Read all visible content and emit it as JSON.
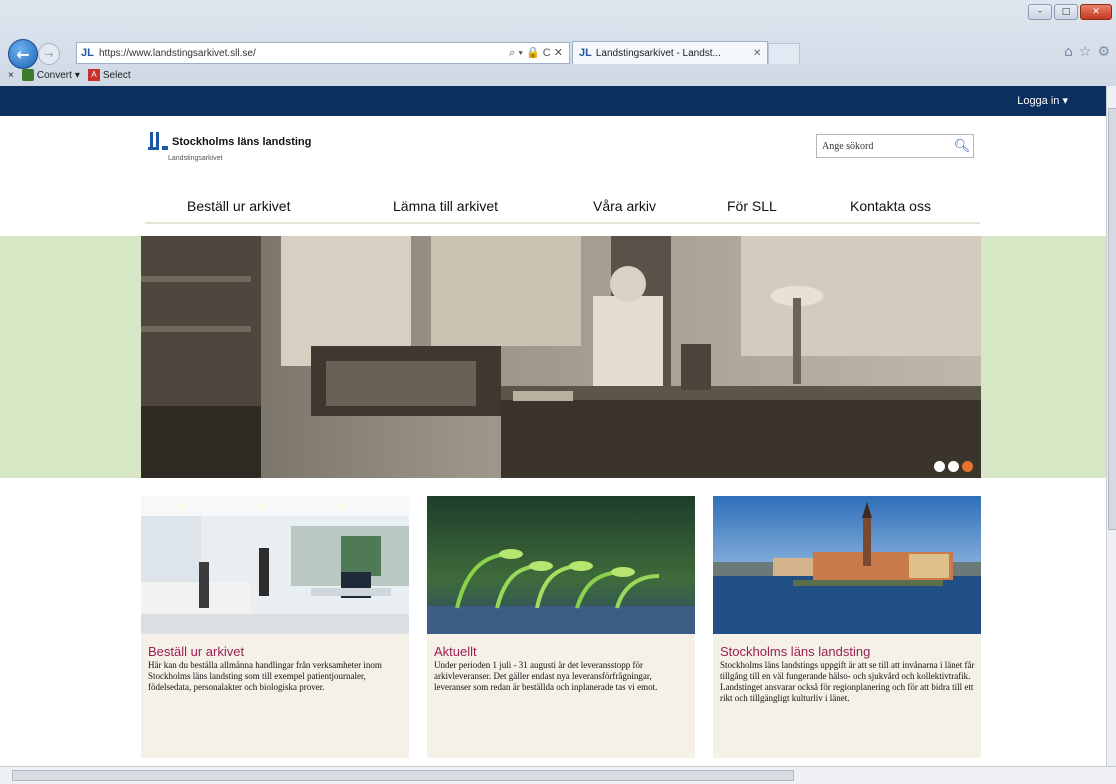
{
  "browser": {
    "url": "https://www.landstingsarkivet.sll.se/",
    "address_controls": "⌕ ▾ 🔒 C ✕",
    "tab_title": "Landstingsarkivet - Landst...",
    "window_controls": [
      "–",
      "□",
      "✕"
    ],
    "toolbar": {
      "close": "×",
      "convert": "Convert",
      "select": "Select"
    },
    "icons": {
      "back": "back-arrow-icon",
      "forward": "forward-arrow-icon",
      "home": "home-icon",
      "favorites": "star-icon",
      "settings": "gear-icon"
    }
  },
  "header": {
    "login": "Logga in ▾",
    "logo_text": "Stockholms läns landsting",
    "logo_subtitle": "Landstingsarkivet",
    "search_placeholder": "Ange sökord"
  },
  "nav": {
    "items": [
      "Beställ ur arkivet",
      "Lämna till arkivet",
      "Våra arkiv",
      "För SLL",
      "Kontakta oss"
    ]
  },
  "hero": {
    "slides": 3,
    "active_slide": 3
  },
  "cards": [
    {
      "title": "Beställ ur arkivet",
      "text": "Här kan du beställa allmänna handlingar från verksamheter inom Stockholms läns landsting som till exempel patientjournaler, födelsedata, personalakter och biologiska prover."
    },
    {
      "title": "Aktuellt",
      "text": "Under perioden 1 juli - 31 augusti är det leveransstopp för arkivleveranser. Det gäller endast nya leveransförfrågningar, leveranser som redan är beställda och inplanerade tas vi emot."
    },
    {
      "title": "Stockholms läns landsting",
      "text": "Stockholms läns landstings uppgift är att se till att invånarna i länet får tillgång till en väl fungerande hälso- och sjukvård och kollektivtrafik. Landstinget ansvarar också för regionplanering och för att bidra till ett rikt och tillgängligt kulturliv i länet."
    }
  ],
  "colors": {
    "topbar": "#0b2f5e",
    "band": "#d7e7c6",
    "card_bg": "#f5f1e8",
    "card_title": "#9c1f55",
    "accent": "#e8732a"
  }
}
